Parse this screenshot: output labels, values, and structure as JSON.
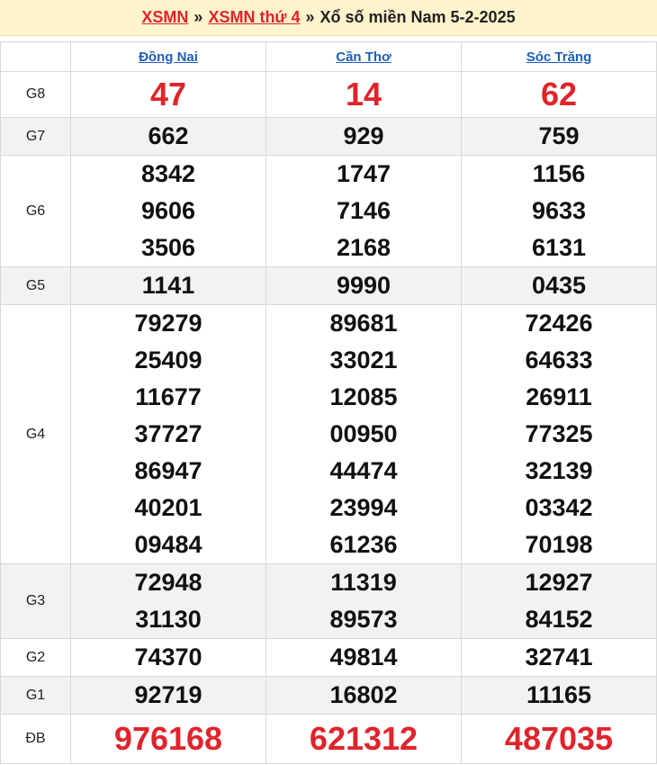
{
  "header": {
    "link1": "XSMN",
    "sep1": "»",
    "link2": "XSMN thứ 4",
    "sep2": "»",
    "title": "Xổ số miền Nam 5-2-2025"
  },
  "columns": [
    "Đồng Nai",
    "Cần Thơ",
    "Sóc Trăng"
  ],
  "prizes": [
    {
      "label": "G8",
      "cells": [
        [
          "47"
        ],
        [
          "14"
        ],
        [
          "62"
        ]
      ]
    },
    {
      "label": "G7",
      "cells": [
        [
          "662"
        ],
        [
          "929"
        ],
        [
          "759"
        ]
      ]
    },
    {
      "label": "G6",
      "cells": [
        [
          "8342",
          "9606",
          "3506"
        ],
        [
          "1747",
          "7146",
          "2168"
        ],
        [
          "1156",
          "9633",
          "6131"
        ]
      ]
    },
    {
      "label": "G5",
      "cells": [
        [
          "1141"
        ],
        [
          "9990"
        ],
        [
          "0435"
        ]
      ]
    },
    {
      "label": "G4",
      "cells": [
        [
          "79279",
          "25409",
          "11677",
          "37727",
          "86947",
          "40201",
          "09484"
        ],
        [
          "89681",
          "33021",
          "12085",
          "00950",
          "44474",
          "23994",
          "61236"
        ],
        [
          "72426",
          "64633",
          "26911",
          "77325",
          "32139",
          "03342",
          "70198"
        ]
      ]
    },
    {
      "label": "G3",
      "cells": [
        [
          "72948",
          "31130"
        ],
        [
          "11319",
          "89573"
        ],
        [
          "12927",
          "84152"
        ]
      ]
    },
    {
      "label": "G2",
      "cells": [
        [
          "74370"
        ],
        [
          "49814"
        ],
        [
          "32741"
        ]
      ]
    },
    {
      "label": "G1",
      "cells": [
        [
          "92719"
        ],
        [
          "16802"
        ],
        [
          "11165"
        ]
      ]
    },
    {
      "label": "ĐB",
      "cells": [
        [
          "976168"
        ],
        [
          "621312"
        ],
        [
          "487035"
        ]
      ]
    }
  ],
  "colors": {
    "accent_red": "#e0242b",
    "link_blue": "#1e60b8",
    "header_bg": "#fff4cc",
    "alt_row_bg": "#f2f2f2"
  }
}
